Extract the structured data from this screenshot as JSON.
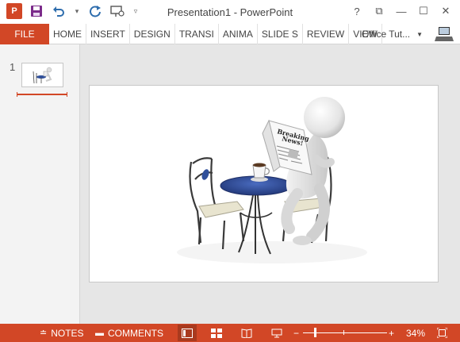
{
  "window": {
    "title": "Presentation1 - PowerPoint",
    "help": "?",
    "ribbon_display": "⧉",
    "minimize": "—",
    "maximize": "☐",
    "close": "✕"
  },
  "quick_access": {
    "app_icon": "P",
    "save_icon": "save-icon",
    "undo_icon": "undo-icon",
    "redo_icon": "redo-icon",
    "present_icon": "present-icon",
    "customize_icon": "customize-icon"
  },
  "ribbon": {
    "file": "FILE",
    "tabs": [
      "HOME",
      "INSERT",
      "DESIGN",
      "TRANSI",
      "ANIMA",
      "SLIDE S",
      "REVIEW",
      "VIEW"
    ],
    "account": "Office Tut...",
    "account_caret": "▼"
  },
  "thumbnails": {
    "slide_number": "1"
  },
  "slide": {
    "image_subject": "stick-figure-reading-breaking-news",
    "newspaper_headline_1": "Breaking",
    "newspaper_headline_2": "News!"
  },
  "statusbar": {
    "notes": "NOTES",
    "comments": "COMMENTS",
    "zoom_minus": "−",
    "zoom_plus": "+",
    "zoom_level": "34%",
    "zoom_fraction": 0.34,
    "fit_icon": "fit-to-window-icon"
  },
  "colors": {
    "accent": "#d24726",
    "accent_dark": "#a93a1e",
    "table_blue": "#2f4f9a"
  }
}
